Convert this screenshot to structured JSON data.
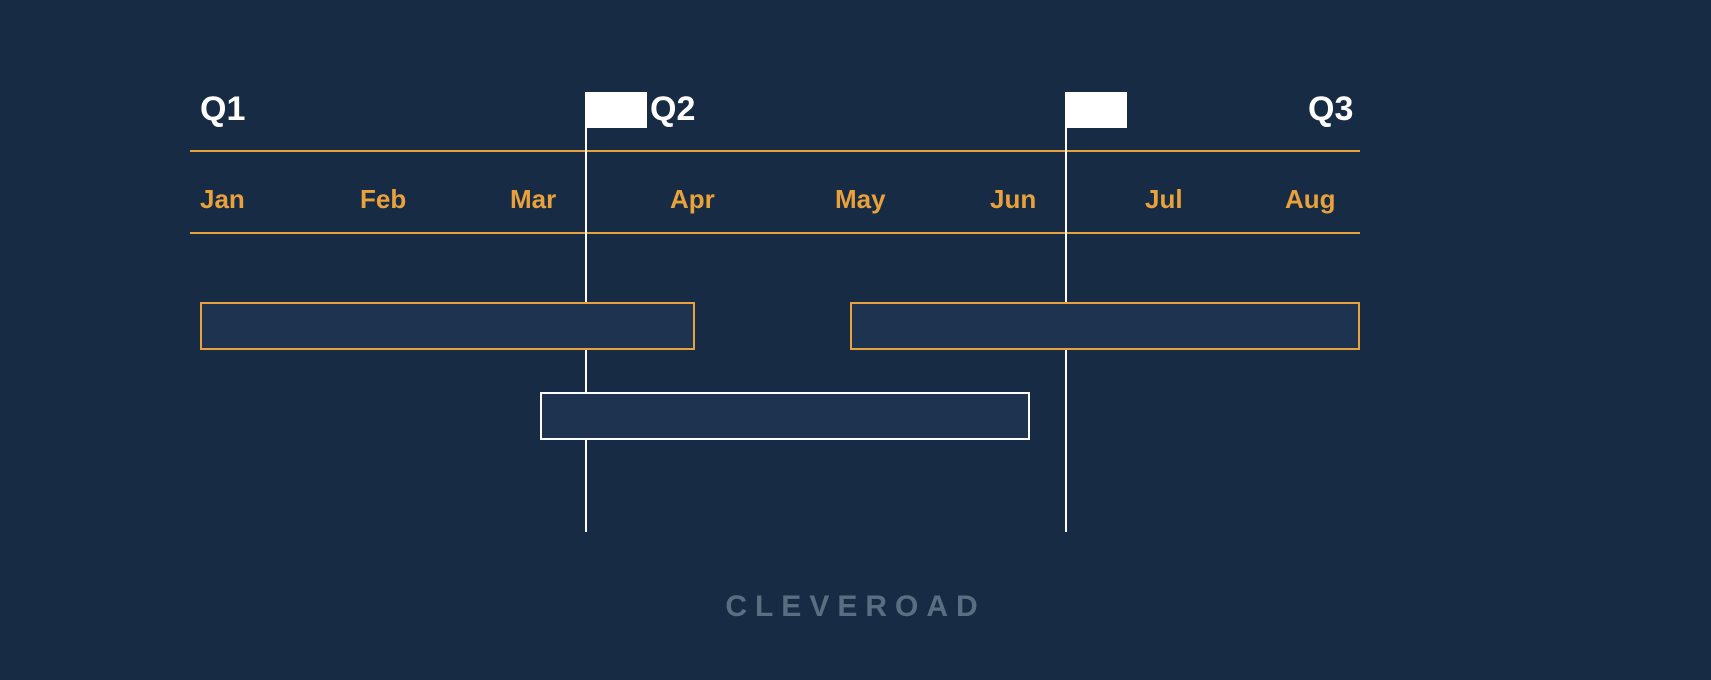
{
  "chart_data": {
    "type": "bar",
    "title": "",
    "xlabel": "",
    "ylabel": "",
    "x_range_months": [
      "Jan",
      "Feb",
      "Mar",
      "Apr",
      "May",
      "Jun",
      "Jul",
      "Aug"
    ],
    "quarters": [
      {
        "label": "Q1",
        "start_month": "Jan"
      },
      {
        "label": "Q2",
        "start_month": "Apr"
      },
      {
        "label": "Q3",
        "start_month": "Jul"
      }
    ],
    "milestones_at_month_start": [
      "Apr",
      "Jul"
    ],
    "tasks": [
      {
        "row": 1,
        "color": "orange",
        "start_month_fraction": 0.0,
        "end_month_fraction": 3.35,
        "label": ""
      },
      {
        "row": 1,
        "color": "orange",
        "start_month_fraction": 4.45,
        "end_month_fraction": 8.0,
        "label": ""
      },
      {
        "row": 2,
        "color": "white",
        "start_month_fraction": 2.35,
        "end_month_fraction": 5.65,
        "label": ""
      }
    ]
  },
  "header": {
    "quarters": [
      "Q1",
      "Q2",
      "Q3"
    ],
    "months": [
      "Jan",
      "Feb",
      "Mar",
      "Apr",
      "May",
      "Jun",
      "Jul",
      "Aug"
    ]
  },
  "watermark": "CLEVEROAD"
}
